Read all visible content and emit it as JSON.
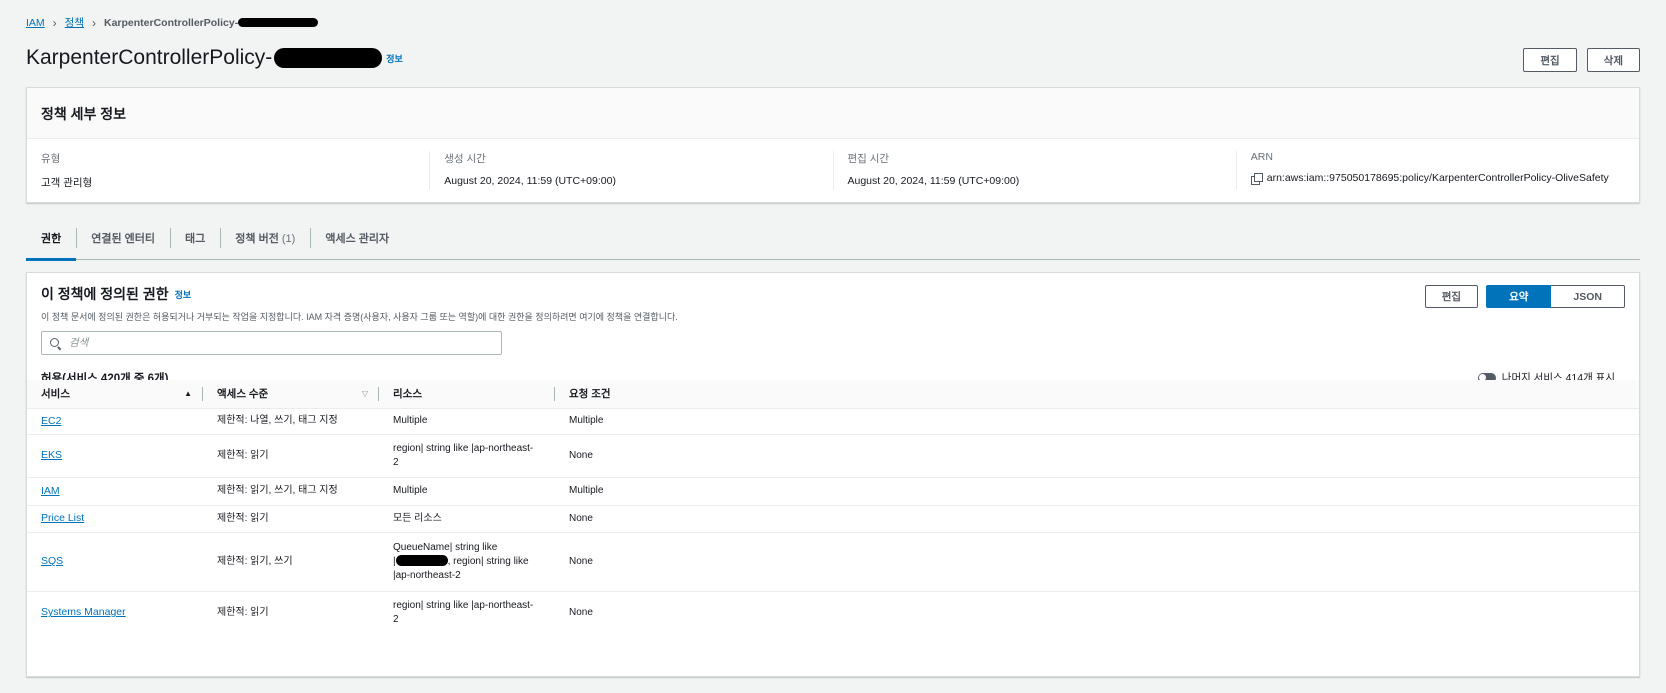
{
  "breadcrumb": {
    "root": "IAM",
    "policies": "정책",
    "current": "KarpenterControllerPolicy-"
  },
  "header": {
    "title": "KarpenterControllerPolicy-",
    "info": "정보",
    "edit_label": "편집",
    "delete_label": "삭제"
  },
  "details": {
    "heading": "정책 세부 정보",
    "type_label": "유형",
    "type_value": "고객 관리형",
    "created_label": "생성 시간",
    "created_value": "August 20, 2024, 11:59 (UTC+09:00)",
    "edited_label": "편집 시간",
    "edited_value": "August 20, 2024, 11:59 (UTC+09:00)",
    "arn_label": "ARN",
    "arn_value": "arn:aws:iam::975050178695:policy/KarpenterControllerPolicy-OliveSafety"
  },
  "tabs": [
    {
      "label": "권한",
      "count": ""
    },
    {
      "label": "연결된 엔터티",
      "count": ""
    },
    {
      "label": "태그",
      "count": ""
    },
    {
      "label": "정책 버전",
      "count": "(1)"
    },
    {
      "label": "액세스 관리자",
      "count": ""
    }
  ],
  "permissions": {
    "title": "이 정책에 정의된 권한",
    "info": "정보",
    "description": "이 정책 문서에 정의된 권한은 허용되거나 거부되는 작업을 지정합니다. IAM 자격 증명(사용자, 사용자 그룹 또는 역할)에 대한 권한을 정의하려면 여기에 정책을 연결합니다.",
    "edit_label": "편집",
    "summary_label": "요약",
    "json_label": "JSON",
    "search_placeholder": "검색",
    "allow_title": "허용(서비스 420개 중 6개)",
    "toggle_label": "나머지 서비스 414개 표시",
    "columns": {
      "service": "서비스",
      "access": "액세스 수준",
      "resource": "리소스",
      "condition": "요청 조건"
    },
    "rows": [
      {
        "service": "EC2",
        "access": "제한적: 나열, 쓰기, 태그 지정",
        "resource": [
          "Multiple"
        ],
        "condition": "Multiple"
      },
      {
        "service": "EKS",
        "access": "제한적: 읽기",
        "resource": [
          "region| string like |ap-northeast-",
          "2"
        ],
        "condition": "None"
      },
      {
        "service": "IAM",
        "access": "제한적: 읽기, 쓰기, 태그 지정",
        "resource": [
          "Multiple"
        ],
        "condition": "Multiple"
      },
      {
        "service": "Price List",
        "access": "제한적: 읽기",
        "resource": [
          "모든 리소스"
        ],
        "condition": "None"
      },
      {
        "service": "SQS",
        "access": "제한적: 읽기, 쓰기",
        "resource": [
          "QueueName| string like",
          "|{redacted}, region| string like",
          "|ap-northeast-2"
        ],
        "condition": "None"
      },
      {
        "service": "Systems Manager",
        "access": "제한적: 읽기",
        "resource": [
          "region| string like |ap-northeast-",
          "2"
        ],
        "condition": "None"
      }
    ]
  },
  "colors": {
    "accent": "#0073bb",
    "background": "#f2f3f3"
  }
}
